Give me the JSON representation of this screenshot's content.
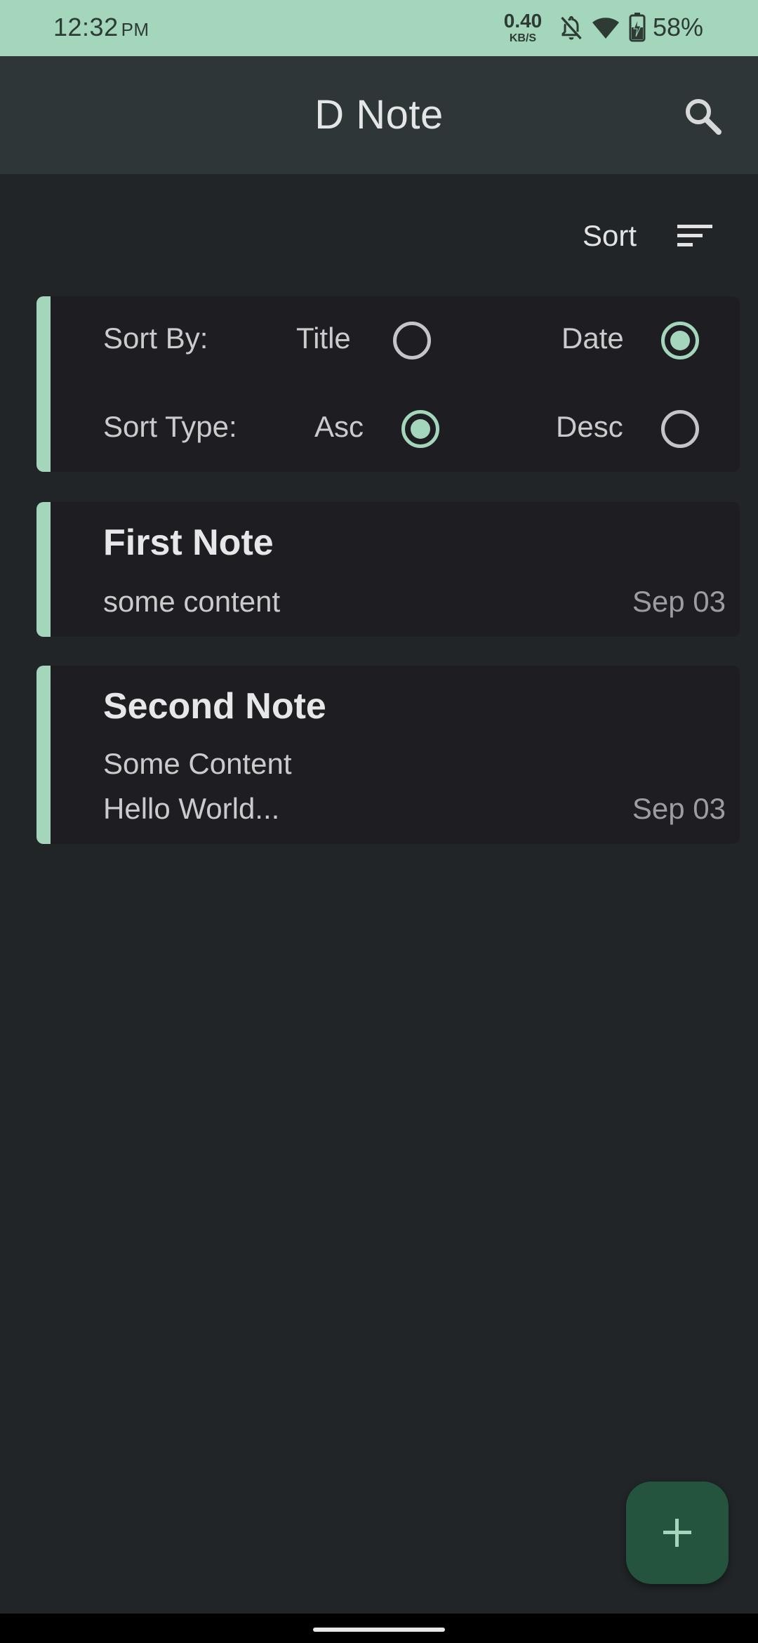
{
  "status_bar": {
    "time": "12:32",
    "ampm": "PM",
    "net_speed": "0.40",
    "net_unit": "KB/S",
    "battery_percent": "58%",
    "icons": [
      "bell-off-icon",
      "wifi-icon",
      "battery-charging-icon"
    ]
  },
  "app_bar": {
    "title": "D Note",
    "search_icon": "search-icon"
  },
  "sort": {
    "label": "Sort",
    "icon": "sort-icon"
  },
  "sort_panel": {
    "sort_by_label": "Sort By:",
    "sort_type_label": "Sort Type:",
    "options": {
      "title": {
        "label": "Title",
        "checked": false
      },
      "date": {
        "label": "Date",
        "checked": true
      },
      "asc": {
        "label": "Asc",
        "checked": true
      },
      "desc": {
        "label": "Desc",
        "checked": false
      }
    }
  },
  "notes": [
    {
      "title": "First Note",
      "lines": [
        "some content"
      ],
      "date": "Sep 03"
    },
    {
      "title": "Second Note",
      "lines": [
        "Some Content",
        "Hello World..."
      ],
      "date": "Sep 03"
    }
  ],
  "fab": {
    "icon": "add-icon"
  },
  "colors": {
    "accent": "#a3d6bb",
    "background": "#212528",
    "app_bar": "#2e3637",
    "card": "#1e1e22",
    "fab": "#24543e"
  }
}
